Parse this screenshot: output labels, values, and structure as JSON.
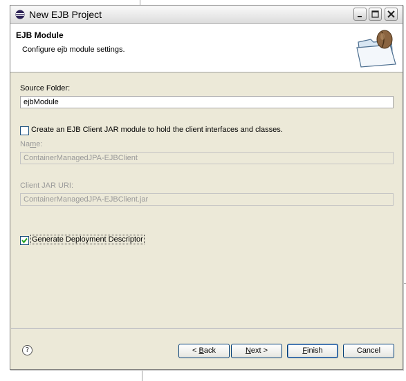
{
  "window": {
    "title": "New EJB Project"
  },
  "header": {
    "title": "EJB Module",
    "description": "Configure ejb module settings."
  },
  "form": {
    "source_folder_label": "Source Folder:",
    "source_folder_value": "ejbModule",
    "create_client_label": "Create an EJB Client JAR module to hold the client interfaces and classes.",
    "create_client_checked": false,
    "name_label_pre": "Na",
    "name_label_mnemonic": "m",
    "name_label_post": "e:",
    "name_value": "ContainerManagedJPA-EJBClient",
    "client_uri_label": "Client JAR URI:",
    "client_uri_value": "ContainerManagedJPA-EJBClient.jar",
    "generate_dd_label": "Generate Deployment Descriptor",
    "generate_dd_checked": true
  },
  "buttons": {
    "help_icon": "?",
    "back_pre": "< ",
    "back_mnemonic": "B",
    "back_post": "ack",
    "next_mnemonic": "N",
    "next_post": "ext >",
    "finish_mnemonic": "F",
    "finish_post": "inish",
    "cancel": "Cancel"
  },
  "icons": {
    "title_icon": "eclipse-icon",
    "header_image": "folder-bean-icon"
  }
}
